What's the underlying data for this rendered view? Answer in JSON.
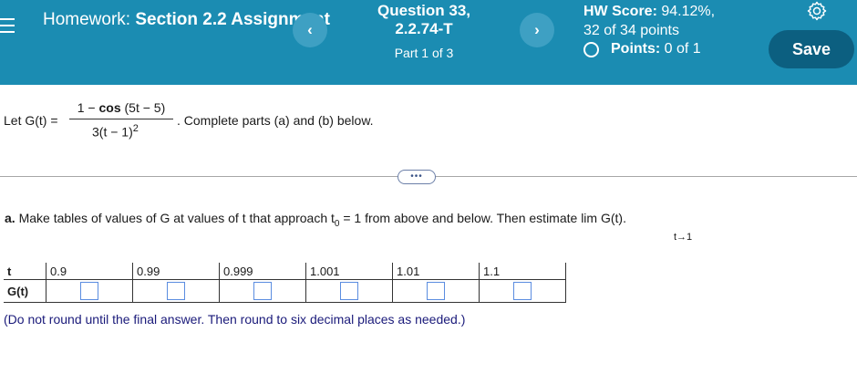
{
  "header": {
    "title_prefix": "Homework:",
    "title_bold": "Section 2.2 Assignment",
    "question": "Question 33,",
    "question_id": "2.2.74-T",
    "part": "Part 1 of 3",
    "hw_score_label": "HW Score:",
    "hw_score_value": "94.12%,",
    "hw_points": "32 of 34 points",
    "points_label": "Points:",
    "points_value": "0 of 1",
    "save_label": "Save",
    "prev_icon": "chevron-left-icon",
    "next_icon": "chevron-right-icon",
    "settings_icon": "gear-icon",
    "color_header": "#1b8cb2",
    "color_save": "#0c5f80"
  },
  "problem": {
    "let": "Let G(t) =",
    "numerator_pre": "1 −",
    "numerator_cos": "cos",
    "numerator_post": "(5t − 5)",
    "denominator": "3(t − 1)",
    "denominator_exp": "2",
    "instruction": ". Complete parts (a) and (b) below.",
    "more_label": "•••"
  },
  "part_a": {
    "label": "a.",
    "text": "Make tables of values of G at values of t that approach t",
    "sub": "0",
    "text2": " = 1 from above and below. Then estimate  lim G(t).",
    "lim_sub": "t→1"
  },
  "table": {
    "row1_label": "t",
    "row2_label": "G(t)",
    "t_values": [
      "0.9",
      "0.99",
      "0.999",
      "1.001",
      "1.01",
      "1.1"
    ]
  },
  "note": "(Do not round until the final answer. Then round to six decimal places as needed.)"
}
